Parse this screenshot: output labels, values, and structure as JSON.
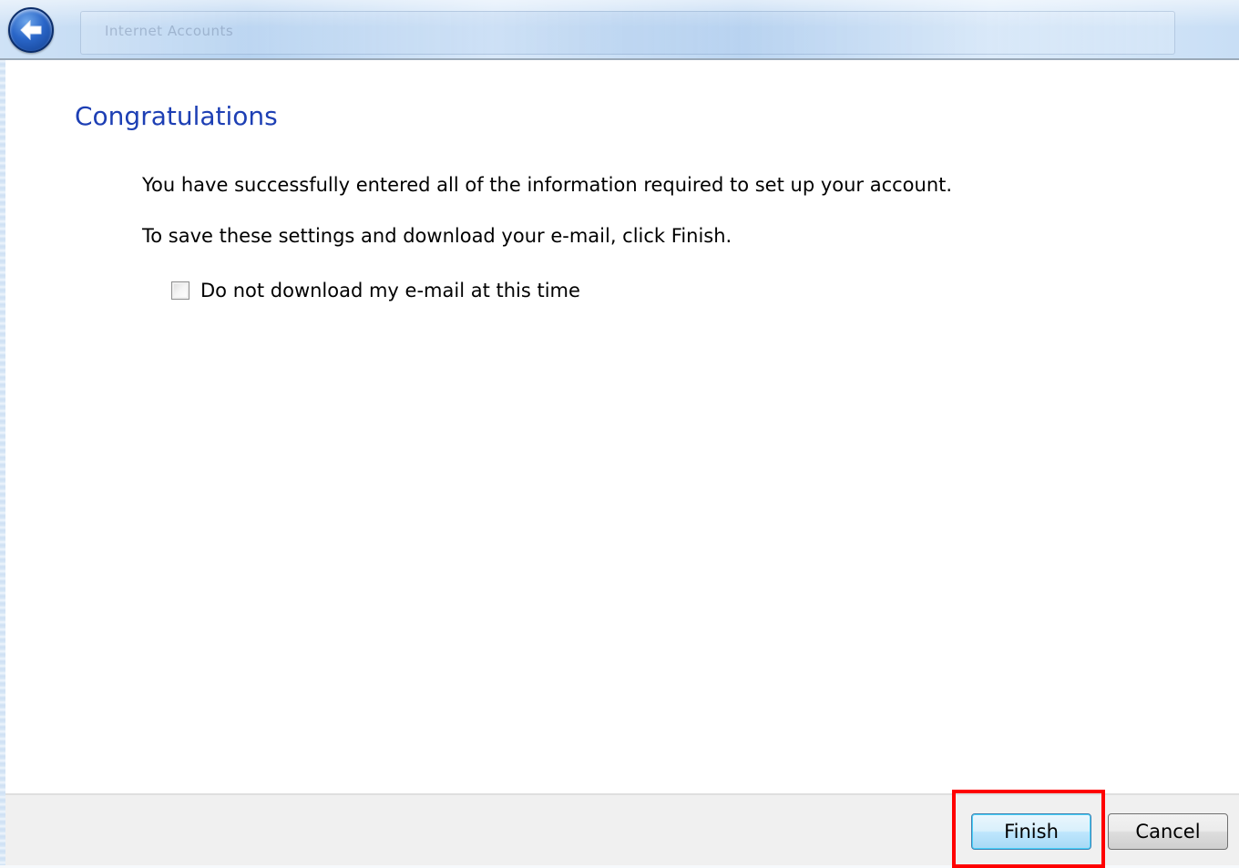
{
  "titlebar": {
    "window_title": "Internet Accounts",
    "back_button": "back-arrow-icon"
  },
  "content": {
    "heading": "Congratulations",
    "message_line1": "You have successfully entered all of the information required to set up your account.",
    "message_line2": "To save these settings and download your e-mail, click Finish.",
    "checkbox_label": "Do not download my e-mail at this time",
    "checkbox_checked": false
  },
  "footer": {
    "finish_label": "Finish",
    "cancel_label": "Cancel"
  },
  "colors": {
    "heading": "#1d3fb4",
    "highlight": "#ff0000"
  }
}
